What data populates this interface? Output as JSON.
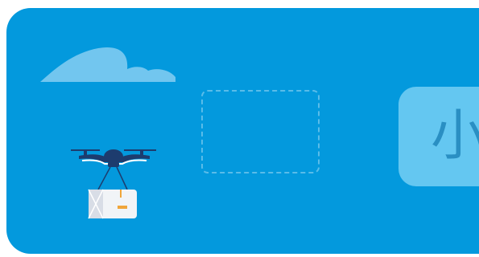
{
  "background_color": "#ffffff",
  "card": {
    "color": "#0399dd"
  },
  "drop_zone": {
    "label": ""
  },
  "answer_tile": {
    "text": "小",
    "color": "#64c7f1",
    "text_color": "#2a8fc3"
  },
  "decorations": {
    "cloud_icon": "cloud-icon",
    "drone_icon": "delivery-drone-icon",
    "package_icon": "package-icon"
  }
}
